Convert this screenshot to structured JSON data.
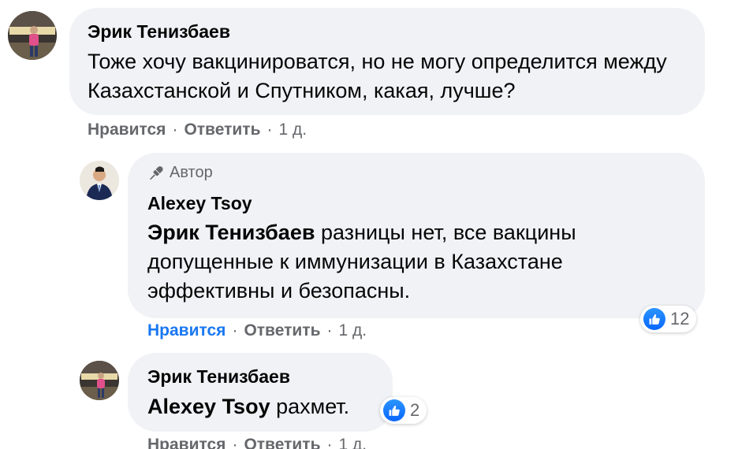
{
  "colors": {
    "bubble": "#f0f2f5",
    "text": "#050505",
    "secondary": "#65676b",
    "accent": "#1877f2"
  },
  "comments": [
    {
      "author": "Эрик Тенизбаев",
      "avatar_icon": "user-avatar-icon",
      "text": "Тоже хочу вакцинироватся, но не могу определится между Казахстанской и Спутником, какая, лучше?",
      "actions": {
        "like": "Нравится",
        "reply": "Ответить",
        "time": "1 д."
      }
    },
    {
      "badge": "Автор",
      "badge_icon": "microphone-icon",
      "author": "Alexey Tsoy",
      "avatar_icon": "user-avatar-icon",
      "mention": "Эрик Тенизбаев",
      "text": " разницы нет, все вакцины допущенные к иммунизации в Казахстане эффективны и безопасны.",
      "reactions": {
        "icon": "thumbs-up-icon",
        "count": "12"
      },
      "actions": {
        "like": "Нравится",
        "reply": "Ответить",
        "time": "1 д.",
        "liked": true
      }
    },
    {
      "author": "Эрик Тенизбаев",
      "avatar_icon": "user-avatar-icon",
      "mention": "Alexey Tsoy",
      "text": " рахмет.",
      "reactions": {
        "icon": "thumbs-up-icon",
        "count": "2"
      },
      "actions": {
        "like": "Нравится",
        "reply": "Ответить",
        "time": "1 д."
      }
    }
  ]
}
